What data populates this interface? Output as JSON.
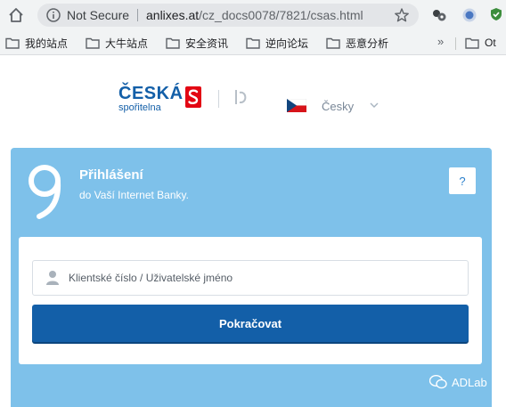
{
  "browser": {
    "security_label": "Not Secure",
    "url_host": "anlixes.at",
    "url_path": "/cz_docs0078/7821/csas.html",
    "bookmarks": [
      {
        "label": "我的站点",
        "icon": "folder-icon"
      },
      {
        "label": "大牛站点",
        "icon": "folder-icon"
      },
      {
        "label": "安全资讯",
        "icon": "folder-icon"
      },
      {
        "label": "逆向论坛",
        "icon": "folder-icon"
      },
      {
        "label": "恶意分析",
        "icon": "folder-icon"
      }
    ],
    "more_bookmarks": "»",
    "other_bookmarks": "Ot"
  },
  "header": {
    "logo_name": "ČESKÁ",
    "logo_sub": "spořitelna",
    "language": "Česky",
    "flag": "czech-flag-icon"
  },
  "login": {
    "title": "Přihlášení",
    "subtitle": "do Vaší Internet Banky.",
    "help": "?",
    "username_placeholder": "Klientské číslo / Uživatelské jméno",
    "submit_label": "Pokračovat"
  },
  "watermark": "ADLab",
  "colors": {
    "brand": "#135fa8",
    "card": "#7ec1ea",
    "logo_red": "#e30613"
  }
}
